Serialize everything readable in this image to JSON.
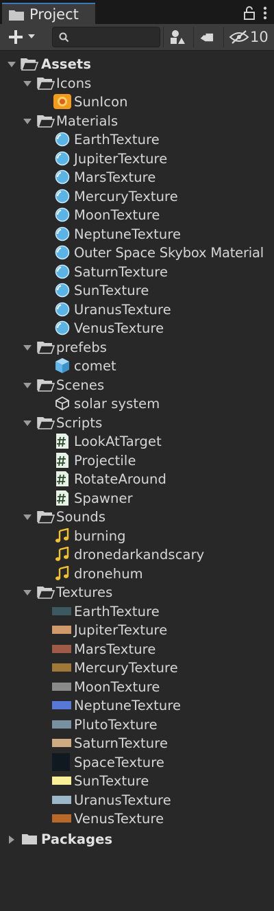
{
  "tab": {
    "title": "Project",
    "icon": "folder-icon"
  },
  "tab_actions": [
    "lock-icon",
    "kebab-menu-icon"
  ],
  "toolbar": {
    "add_icon": "plus-icon",
    "search_icon": "search-icon",
    "search_value": "",
    "hidden_count": "10"
  },
  "tree": {
    "assets": "Assets",
    "icons": "Icons",
    "sun_icon": "SunIcon",
    "materials": "Materials",
    "material_items": [
      "EarthTexture",
      "JupiterTexture",
      "MarsTexture",
      "MercuryTexture",
      "MoonTexture",
      "NeptuneTexture",
      "Outer Space Skybox Material",
      "SaturnTexture",
      "SunTexture",
      "UranusTexture",
      "VenusTexture"
    ],
    "prefebs": "prefebs",
    "comet": "comet",
    "scenes": "Scenes",
    "solar_system": "solar system",
    "scripts": "Scripts",
    "script_items": [
      "LookAtTarget",
      "Projectile",
      "RotateAround",
      "Spawner"
    ],
    "sounds": "Sounds",
    "sound_items": [
      "burning",
      "dronedarkandscary",
      "dronehum"
    ],
    "textures": "Textures",
    "texture_items": [
      "EarthTexture",
      "JupiterTexture",
      "MarsTexture",
      "MercuryTexture",
      "MoonTexture",
      "NeptuneTexture",
      "PlutoTexture",
      "SaturnTexture",
      "SpaceTexture",
      "SunTexture",
      "UranusTexture",
      "VenusTexture"
    ],
    "packages": "Packages"
  },
  "colors": {
    "background": "#282828",
    "tab_accent": "#3a79bb",
    "material_sphere": "#5bb4e6",
    "script_icon": "#dfeee0",
    "sound_icon": "#f2c230",
    "prefab_cube": "#62b7e8"
  },
  "texture_swatches": [
    "#3c5860",
    "#d09a6a",
    "#a05a48",
    "#a07838",
    "#8a8a8a",
    "#5878d8",
    "#7890a0",
    "#d0aa80",
    "#101820",
    "#f8f098",
    "#9cb8c8",
    "#b86828"
  ]
}
